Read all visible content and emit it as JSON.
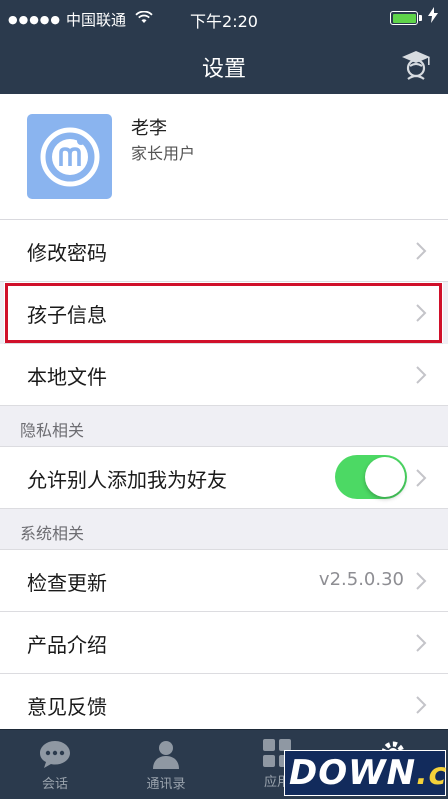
{
  "status_bar": {
    "signal": "●●●●●",
    "carrier": "中国联通",
    "time": "下午2:20"
  },
  "nav": {
    "title": "设置"
  },
  "profile": {
    "name": "老李",
    "role": "家长用户"
  },
  "rows": [
    {
      "label": "修改密码"
    },
    {
      "label": "孩子信息"
    },
    {
      "label": "本地文件"
    }
  ],
  "privacy": {
    "section": "隐私相关",
    "toggle_label": "允许别人添加我为好友",
    "toggle_on": true
  },
  "system": {
    "section": "系统相关",
    "update_label": "检查更新",
    "version": "v2.5.0.30",
    "intro_label": "产品介绍",
    "feedback_label": "意见反馈"
  },
  "tabs": [
    {
      "label": "会话",
      "icon": "chat-icon"
    },
    {
      "label": "通讯录",
      "icon": "contacts-icon"
    },
    {
      "label": "应用",
      "icon": "apps-icon"
    },
    {
      "label": "",
      "icon": "settings-icon"
    }
  ],
  "watermark": {
    "text": "DOWN",
    "suffix": ".cc"
  },
  "colors": {
    "nav_bg": "#2b3a4d",
    "toggle_on": "#4cd964",
    "highlight": "#d0102a",
    "avatar_bg": "#8ab4ef"
  }
}
